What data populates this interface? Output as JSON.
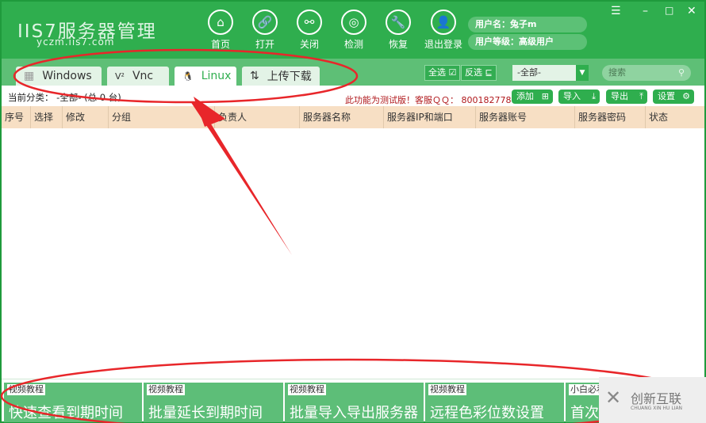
{
  "app": {
    "logo": "IIS7服务器管理",
    "subtitle": "yczm.iis7.com"
  },
  "nav": [
    {
      "label": "首页",
      "icon": "⌂"
    },
    {
      "label": "打开",
      "icon": "🔗"
    },
    {
      "label": "关闭",
      "icon": "⚯"
    },
    {
      "label": "检测",
      "icon": "◎"
    },
    {
      "label": "恢复",
      "icon": "🔧"
    },
    {
      "label": "退出登录",
      "icon": "👤"
    }
  ],
  "user": {
    "name": "用户名：兔子m",
    "level": "用户等级：高级用户"
  },
  "tabs": [
    {
      "label": "Windows",
      "icon": "▦"
    },
    {
      "label": "Vnc",
      "icon": "V²"
    },
    {
      "label": "Linux",
      "icon": "🐧"
    },
    {
      "label": "上传下载",
      "icon": "⇅"
    }
  ],
  "toolbar": {
    "select_all": "全选",
    "invert": "反选",
    "category": "-全部-",
    "search_placeholder": "搜索"
  },
  "info": {
    "current": "当前分类：  -全部- (总 0 台)",
    "notice": "此功能为测试版！客服ＱＱ： 800182778"
  },
  "actions": [
    {
      "label": "添加",
      "icon": "⊞"
    },
    {
      "label": "导入",
      "icon": "⤓"
    },
    {
      "label": "导出",
      "icon": "⤒"
    },
    {
      "label": "设置",
      "icon": "⚙"
    }
  ],
  "columns": [
    "序号",
    "选择",
    "修改",
    "分组",
    "负责人",
    "服务器名称",
    "服务器IP和端口",
    "服务器账号",
    "服务器密码",
    "状态"
  ],
  "tiles": [
    {
      "tag": "视频教程",
      "title": "快速查看到期时间"
    },
    {
      "tag": "视频教程",
      "title": "批量延长到期时间"
    },
    {
      "tag": "视频教程",
      "title": "批量导入导出服务器"
    },
    {
      "tag": "视频教程",
      "title": "远程色彩位数设置"
    },
    {
      "tag": "小白必看",
      "title": "首次使用"
    }
  ],
  "watermark": {
    "name": "创新互联",
    "sub": "CHUANG XIN HU LIAN"
  }
}
